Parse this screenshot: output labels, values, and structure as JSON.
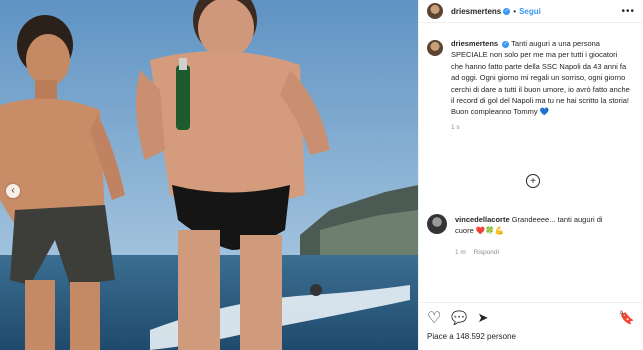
{
  "header": {
    "username": "driesmertens",
    "separator": "•",
    "follow_label": "Segui",
    "more_label": "•••",
    "verified_label": "✓"
  },
  "caption": {
    "username": "driesmertens",
    "text": "Tanti auguri a una persona SPECIALE non solo per me ma per tutti i giocatori che hanno fatto parte della SSC Napoli da 43 anni fa ad oggi. Ogni giorno mi regali un sorriso, ogni giorno cerchi di dare a tutti il buon umore, io avrò fatto anche il record di gol del Napoli ma tu ne hai scritto la storia! Buon compleanno Tommy 💙",
    "time": "1 s"
  },
  "load_more_label": "+",
  "comment": {
    "username": "vincedellacorte",
    "text": "Grandeeee... tanti auguri di cuore ❤️🍀💪",
    "time": "1 m",
    "reply_label": "Rispondi"
  },
  "actions": {
    "like_icon": "♡",
    "comment_icon": "💬",
    "share_icon": "➤",
    "save_icon": "🔖"
  },
  "likes": "Piace a 148.592 persone",
  "carousel": {
    "prev_label": "‹"
  },
  "colors": {
    "accent": "#3897f0",
    "sky": "#6f9fc9",
    "sea": "#2e5f86"
  }
}
